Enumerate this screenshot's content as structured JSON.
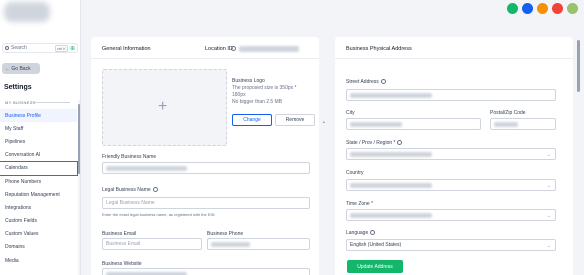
{
  "sidebar": {
    "search_placeholder": "Search",
    "search_shortcut": "ctrl K",
    "go_back": "← Go Back",
    "title": "Settings",
    "section_label": "MY BUSINESS",
    "items": [
      {
        "label": "Business Profile",
        "active": true
      },
      {
        "label": "My Staff"
      },
      {
        "label": "Pipelines"
      },
      {
        "label": "Conversation AI"
      },
      {
        "label": "Calendars",
        "highlighted": true
      },
      {
        "label": "Phone Numbers"
      },
      {
        "label": "Reputation Management"
      },
      {
        "label": "Integrations"
      },
      {
        "label": "Custom Fields"
      },
      {
        "label": "Custom Values"
      },
      {
        "label": "Domains"
      },
      {
        "label": "Media"
      }
    ]
  },
  "topbar": {
    "icons": [
      {
        "name": "phone-icon",
        "color": "#12b76a"
      },
      {
        "name": "megaphone-icon",
        "color": "#155eef"
      },
      {
        "name": "notification-icon",
        "color": "#f79009"
      },
      {
        "name": "help-icon",
        "color": "#f04438"
      },
      {
        "name": "avatar",
        "color": "#98c26b"
      }
    ]
  },
  "general": {
    "title": "General Information",
    "location_label": "Location ID",
    "logo": {
      "title": "Business Logo",
      "line1": "The proposed size is 350px *",
      "line2": "180px",
      "line3": "No bigger than 2.5 MB",
      "change": "Change",
      "remove": "Remove"
    },
    "friendly_name_label": "Friendly Business Name",
    "legal_name_label": "Legal Business Name",
    "legal_name_placeholder": "Legal Business Name",
    "legal_name_help": "Enter the exact legal business name, as registered with the EIN",
    "email_label": "Business Email",
    "email_placeholder": "Business Email",
    "phone_label": "Business Phone",
    "website_label": "Business Website"
  },
  "address": {
    "title": "Business Physical Address",
    "street_label": "Street Address",
    "city_label": "City",
    "postal_label": "Postal/Zip Code",
    "state_label": "State / Prov / Region *",
    "country_label": "Country",
    "timezone_label": "Time Zone *",
    "language_label": "Language",
    "language_value": "English (United States)",
    "update_button": "Update Address"
  }
}
